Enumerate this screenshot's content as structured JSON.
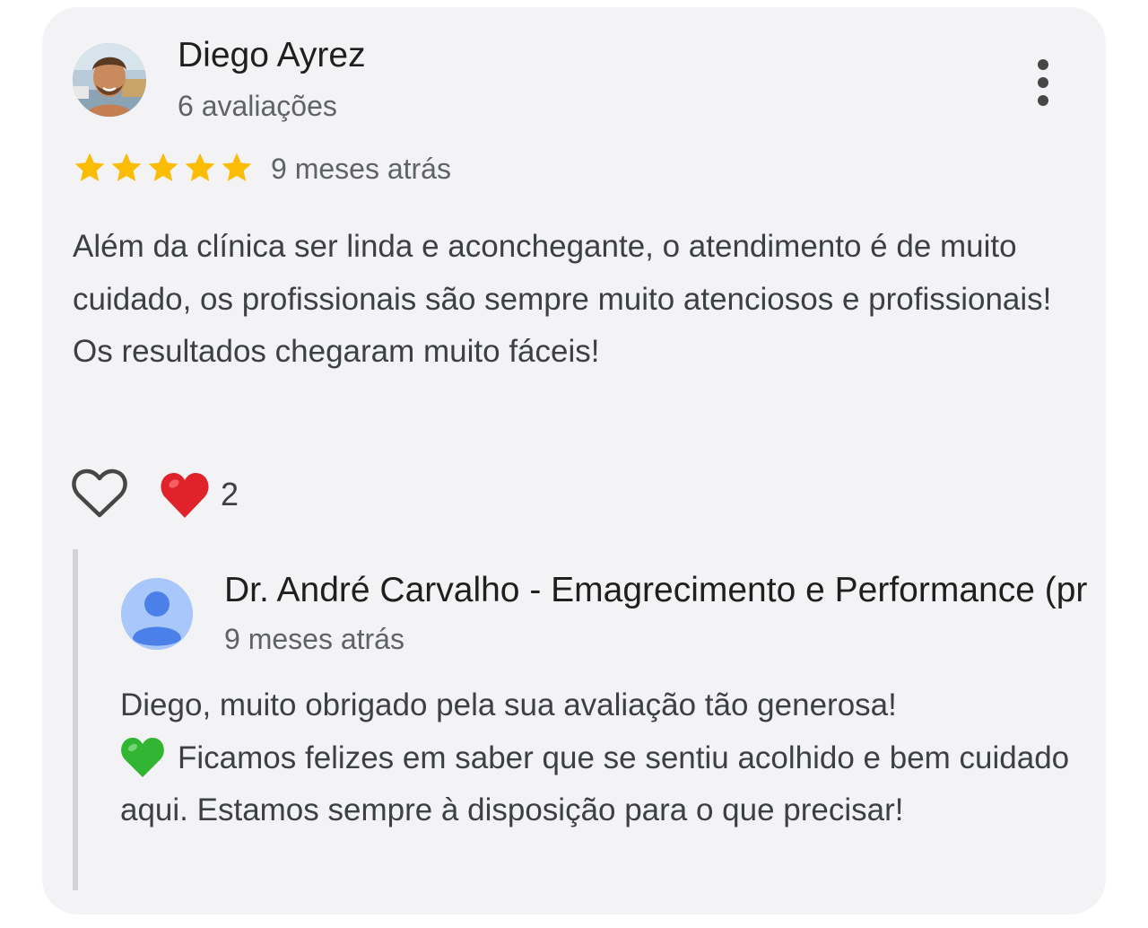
{
  "review": {
    "reviewer_name": "Diego Ayrez",
    "reviewer_count": "6 avaliações",
    "rating": 5,
    "rating_max": 5,
    "time": "9 meses atrás",
    "text": "Além da clínica ser linda e aconchegante, o atendimento é de muito cuidado, os profissionais são sempre muito atenciosos e profissionais! Os resultados chegaram muito fáceis!",
    "reaction_count": "2",
    "icons": {
      "avatar": "user-photo-avatar",
      "more": "more-vert-icon",
      "like": "heart-outline-icon",
      "reaction": "red-heart-emoji"
    }
  },
  "reply": {
    "owner_name": "Dr. André Carvalho - Emagrecimento e Performance (pr",
    "time": "9 meses atrás",
    "text_line1": "Diego, muito obrigado pela sua avaliação tão generosa!",
    "text_rest": "Ficamos felizes em saber que se sentiu acolhido e bem cuidado aqui. Estamos sempre à disposição para o que precisar!",
    "icons": {
      "avatar": "default-person-avatar",
      "emoji": "green-heart-emoji"
    }
  },
  "colors": {
    "card_background": "#f3f3f5",
    "star": "#fbbc04",
    "primary_text": "#1f1f1f",
    "secondary_text": "#5f6368",
    "body_text": "#3c4043",
    "reaction_heart": "#e0222b",
    "green_heart": "#32b532",
    "owner_avatar_bg": "#a8c7fa",
    "owner_avatar_fg": "#4a80e8"
  }
}
